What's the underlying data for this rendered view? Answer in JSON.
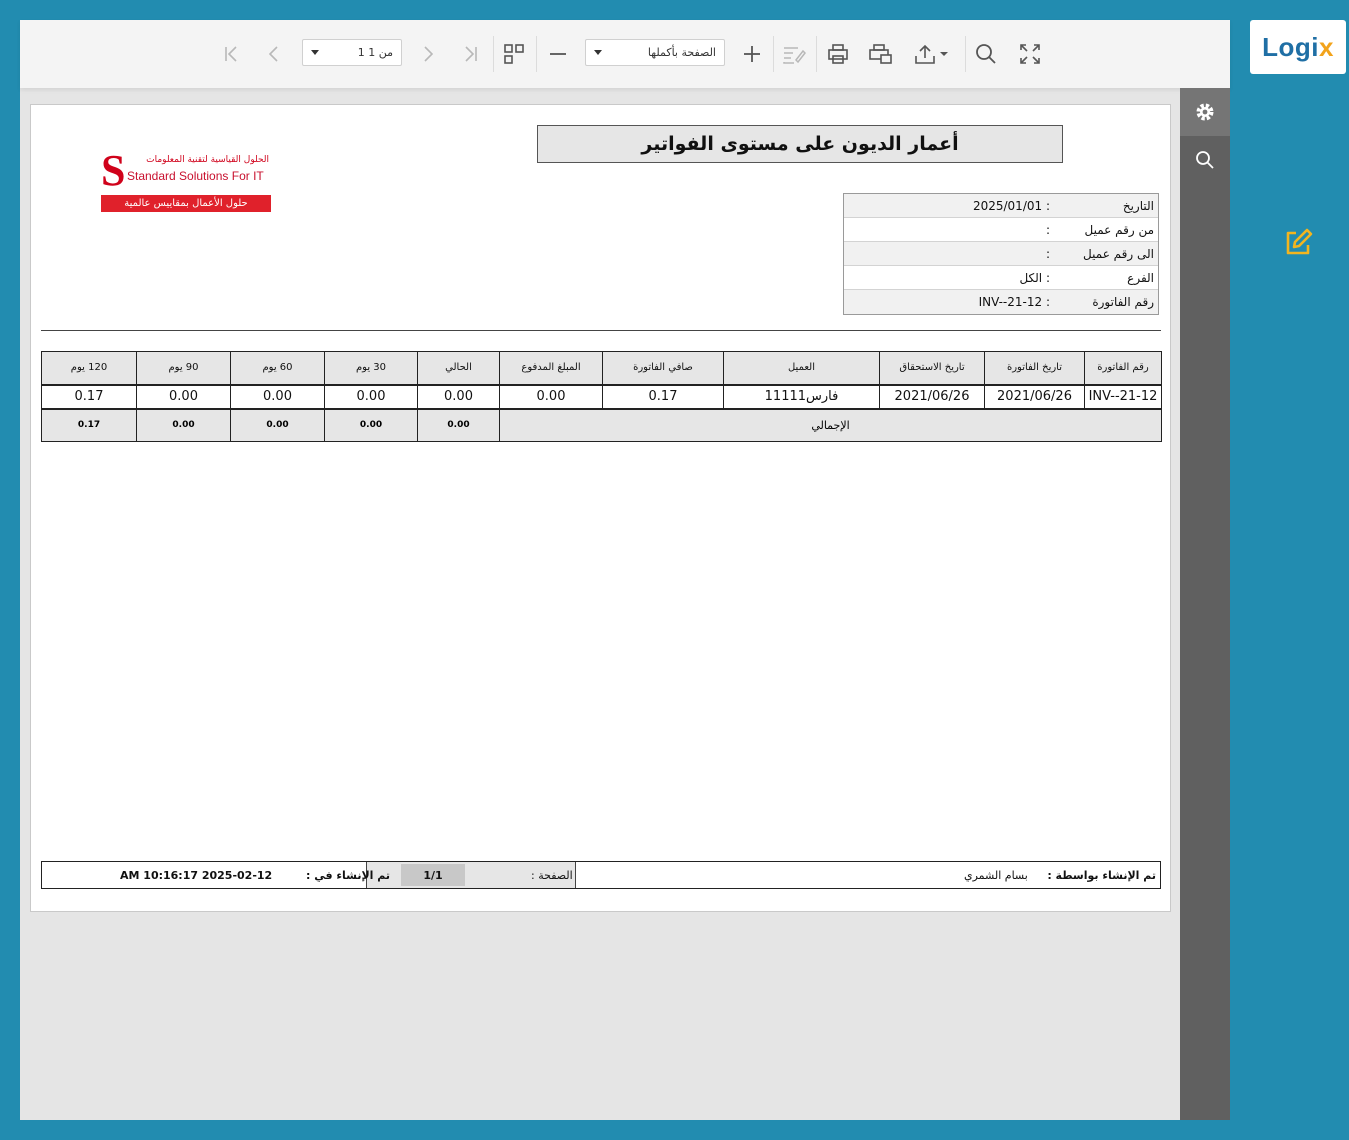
{
  "toolbar": {
    "page_select": "من 1 1",
    "zoom_select": "الصفحة بأكملها"
  },
  "report": {
    "title": "أعمار الديون على مستوى الفواتير",
    "logo": {
      "arabic_line": "الحلول القياسية لتقنية المعلومات",
      "english_line": "Standard Solutions For IT",
      "tagline": "حلول الأعمال بمقاييس عالمية",
      "letter": "S"
    },
    "info": [
      {
        "label": "التاريخ",
        "value": ": 2025/01/01"
      },
      {
        "label": "من رقم عميل",
        "value": ":"
      },
      {
        "label": "الى رقم عميل",
        "value": ":"
      },
      {
        "label": "الفرع",
        "value": ": الكل"
      },
      {
        "label": "رقم الفاتورة",
        "value": ": INV--21-12"
      }
    ],
    "table": {
      "headers": [
        "رقم الفاتورة",
        "تاريخ الفاتورة",
        "تاريخ الاستحقاق",
        "العميل",
        "صافي الفاتورة",
        "المبلغ المدفوع",
        "الحالي",
        "30 يوم",
        "60 يوم",
        "90 يوم",
        "120 يوم"
      ],
      "rows": [
        [
          "INV--21-12",
          "2021/06/26",
          "2021/06/26",
          "فارس11111",
          "0.17",
          "0.00",
          "0.00",
          "0.00",
          "0.00",
          "0.00",
          "0.17"
        ]
      ],
      "total_label": "الإجمالي",
      "totals": [
        "0.00",
        "0.00",
        "0.00",
        "0.00",
        "0.17"
      ]
    },
    "footer": {
      "created_by_label": "تم الإنشاء بواسطة :",
      "created_by": "بسام الشمري",
      "page_label": "الصفحة :",
      "page_value": "1/1",
      "created_at_label": "تم الإنشاء في :",
      "created_at": "AM 10:16:17 2025-02-12"
    }
  },
  "brand": {
    "name_main": "Logi",
    "name_accent": "x"
  },
  "icons": {
    "first": "first-page-icon",
    "prev": "prev-page-icon",
    "next": "next-page-icon",
    "last": "last-page-icon",
    "multipage": "multipage-icon",
    "zoom_out": "zoom-out-icon",
    "zoom_in": "zoom-in-icon",
    "editing": "editing-fields-icon",
    "print": "print-icon",
    "print_page": "print-page-icon",
    "export": "export-icon",
    "search": "search-icon",
    "fullscreen": "fullscreen-icon",
    "settings": "gear-icon",
    "edit": "edit-icon"
  },
  "colors": {
    "background": "#228cb0",
    "side_panel": "#606060",
    "header_fill": "#e6e6e6",
    "logo_red": "#e0212b",
    "edit_icon": "#f2b51f"
  }
}
